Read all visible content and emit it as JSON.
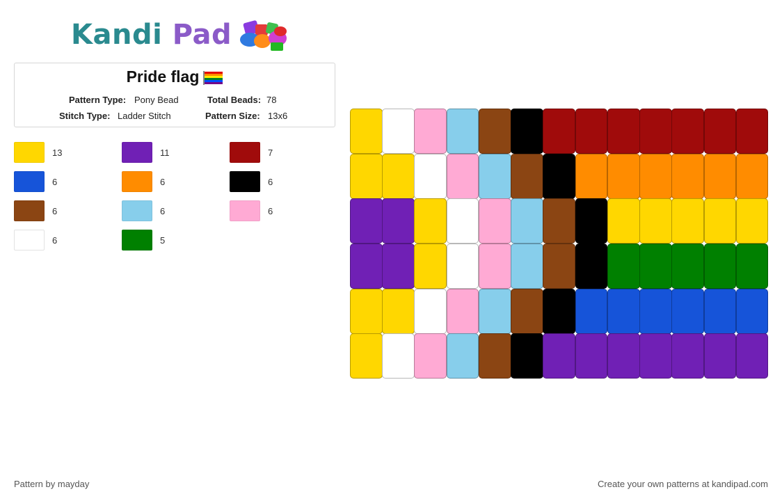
{
  "logo": {
    "word1": "Kandi",
    "word2": "Pad",
    "icon": "beads-icon"
  },
  "pattern": {
    "title": "Pride flag",
    "title_icon": "rainbow-flag-icon",
    "type_label": "Pattern Type:",
    "type_value": "Pony Bead",
    "total_label": "Total Beads:",
    "total_value": "78",
    "stitch_label": "Stitch Type:",
    "stitch_value": "Ladder Stitch",
    "size_label": "Pattern Size:",
    "size_value": "13x6"
  },
  "colors": {
    "Y": "#ffd700",
    "W": "#ffffff",
    "P": "#ffaad4",
    "L": "#87ceeb",
    "N": "#8b4513",
    "K": "#000000",
    "R": "#a00b0b",
    "O": "#ff8c00",
    "G": "#008000",
    "B": "#1654d9",
    "V": "#7020b5"
  },
  "legend": [
    {
      "color": "#ffd700",
      "count": "13"
    },
    {
      "color": "#7020b5",
      "count": "11"
    },
    {
      "color": "#a00b0b",
      "count": "7"
    },
    {
      "color": "#1654d9",
      "count": "6"
    },
    {
      "color": "#ff8c00",
      "count": "6"
    },
    {
      "color": "#000000",
      "count": "6"
    },
    {
      "color": "#8b4513",
      "count": "6"
    },
    {
      "color": "#87ceeb",
      "count": "6"
    },
    {
      "color": "#ffaad4",
      "count": "6"
    },
    {
      "color": "#ffffff",
      "count": "6"
    },
    {
      "color": "#008000",
      "count": "5"
    }
  ],
  "grid": {
    "columns": 13,
    "rows": [
      [
        "Y",
        "W",
        "P",
        "L",
        "N",
        "K",
        "R",
        "R",
        "R",
        "R",
        "R",
        "R",
        "R"
      ],
      [
        "Y",
        "Y",
        "W",
        "P",
        "L",
        "N",
        "K",
        "O",
        "O",
        "O",
        "O",
        "O",
        "O"
      ],
      [
        "V",
        "V",
        "Y",
        "W",
        "P",
        "L",
        "N",
        "K",
        "Y",
        "Y",
        "Y",
        "Y",
        "Y"
      ],
      [
        "V",
        "V",
        "Y",
        "W",
        "P",
        "L",
        "N",
        "K",
        "G",
        "G",
        "G",
        "G",
        "G"
      ],
      [
        "Y",
        "Y",
        "W",
        "P",
        "L",
        "N",
        "K",
        "B",
        "B",
        "B",
        "B",
        "B",
        "B"
      ],
      [
        "Y",
        "W",
        "P",
        "L",
        "N",
        "K",
        "V",
        "V",
        "V",
        "V",
        "V",
        "V",
        "V"
      ]
    ]
  },
  "footer": {
    "credit": "Pattern by mayday",
    "cta": "Create your own patterns at kandipad.com"
  }
}
